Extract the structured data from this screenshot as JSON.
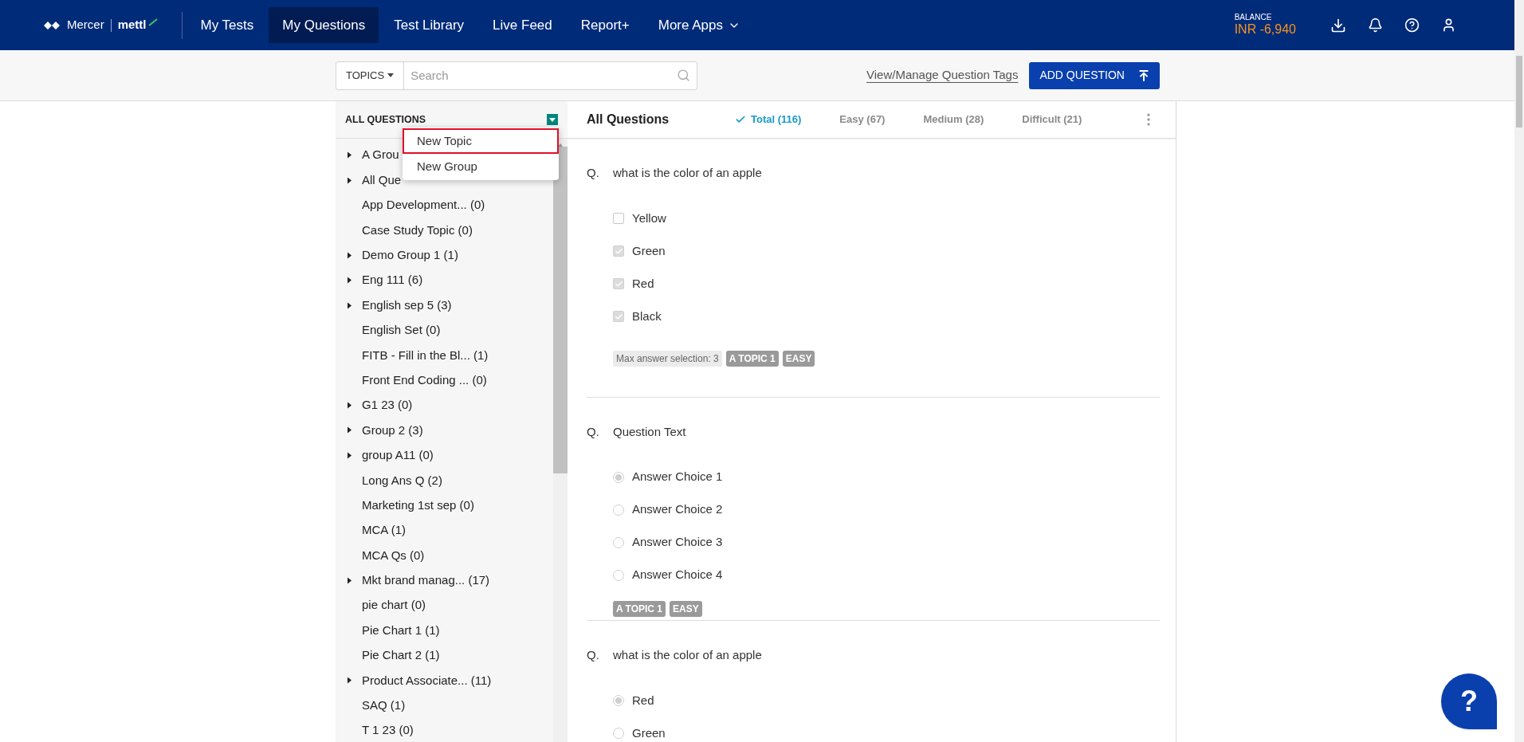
{
  "header": {
    "logo": {
      "brand": "Mercer",
      "product": "mettl"
    },
    "nav": [
      {
        "label": "My Tests",
        "selected": false
      },
      {
        "label": "My Questions",
        "selected": true
      },
      {
        "label": "Test Library",
        "selected": false
      },
      {
        "label": "Live Feed",
        "selected": false
      },
      {
        "label": "Report+",
        "selected": false
      },
      {
        "label": "More Apps",
        "selected": false,
        "kind": "dropdown"
      }
    ],
    "balance": {
      "label": "BALANCE",
      "value": "INR -6,940"
    }
  },
  "toolbar": {
    "topics_button": "TOPICS",
    "search": {
      "placeholder": "Search"
    },
    "tags_link": "View/Manage Question Tags",
    "add_button": "ADD QUESTION"
  },
  "sidebar": {
    "title": "ALL QUESTIONS",
    "menu": [
      {
        "label": "New Topic",
        "selected": true
      },
      {
        "label": "New Group",
        "selected": false
      }
    ],
    "items": [
      {
        "label": "A Grou",
        "kind": "group"
      },
      {
        "label": "All Que",
        "kind": "group"
      },
      {
        "label": "App Development... (0)",
        "kind": "topic"
      },
      {
        "label": "Case Study Topic (0)",
        "kind": "topic"
      },
      {
        "label": "Demo Group 1 (1)",
        "kind": "group"
      },
      {
        "label": "Eng 111 (6)",
        "kind": "group"
      },
      {
        "label": "English sep 5 (3)",
        "kind": "group"
      },
      {
        "label": "English Set (0)",
        "kind": "topic"
      },
      {
        "label": "FITB - Fill in the Bl...  (1)",
        "kind": "topic"
      },
      {
        "label": "Front End Coding ... (0)",
        "kind": "topic"
      },
      {
        "label": "G1 23 (0)",
        "kind": "group"
      },
      {
        "label": "Group 2 (3)",
        "kind": "group"
      },
      {
        "label": "group A11 (0)",
        "kind": "group"
      },
      {
        "label": "Long Ans Q (2)",
        "kind": "topic"
      },
      {
        "label": "Marketing 1st sep (0)",
        "kind": "topic"
      },
      {
        "label": "MCA (1)",
        "kind": "topic"
      },
      {
        "label": "MCA Qs (0)",
        "kind": "topic"
      },
      {
        "label": "Mkt brand manag... (17)",
        "kind": "group"
      },
      {
        "label": "pie chart (0)",
        "kind": "topic"
      },
      {
        "label": "Pie Chart 1 (1)",
        "kind": "topic"
      },
      {
        "label": "Pie Chart 2 (1)",
        "kind": "topic"
      },
      {
        "label": "Product Associate... (11)",
        "kind": "group"
      },
      {
        "label": "SAQ (1)",
        "kind": "topic"
      },
      {
        "label": "T 1 23 (0)",
        "kind": "topic"
      }
    ]
  },
  "main": {
    "title": "All Questions",
    "filters": [
      {
        "label": "Total (116)",
        "selected": true
      },
      {
        "label": "Easy (67)",
        "selected": false
      },
      {
        "label": "Medium (28)",
        "selected": false
      },
      {
        "label": "Difficult (21)",
        "selected": false
      }
    ],
    "questions": [
      {
        "prefix": "Q.",
        "text": "what is the color of an apple",
        "kind": "checkbox",
        "options": [
          {
            "label": "Yellow",
            "checked": false
          },
          {
            "label": "Green",
            "checked": true
          },
          {
            "label": "Red",
            "checked": true
          },
          {
            "label": "Black",
            "checked": true
          }
        ],
        "note": "Max answer selection: 3",
        "tags": [
          "A TOPIC 1",
          "EASY"
        ]
      },
      {
        "prefix": "Q.",
        "text": "Question Text",
        "kind": "radio",
        "options": [
          {
            "label": "Answer Choice 1",
            "checked": true
          },
          {
            "label": "Answer Choice 2",
            "checked": false
          },
          {
            "label": "Answer Choice 3",
            "checked": false
          },
          {
            "label": "Answer Choice 4",
            "checked": false
          }
        ],
        "tags": [
          "A TOPIC 1",
          "EASY"
        ]
      },
      {
        "prefix": "Q.",
        "text": "what is the color of an apple",
        "kind": "radio",
        "options": [
          {
            "label": "Red",
            "checked": true
          },
          {
            "label": "Green",
            "checked": false
          }
        ]
      }
    ]
  },
  "help_button": "?"
}
